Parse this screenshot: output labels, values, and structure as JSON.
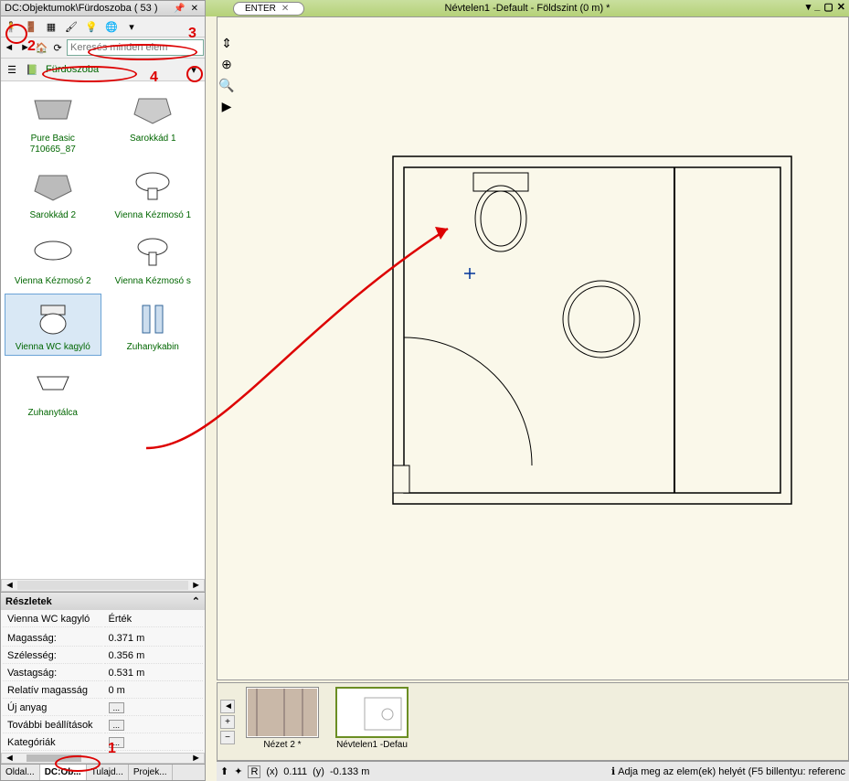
{
  "panel": {
    "title": "DC:Objektumok\\Fürdoszoba ( 53 )",
    "search_placeholder": "Keresés minden elem",
    "breadcrumb": "Fürdoszoba"
  },
  "objects": [
    {
      "label": "Pure Basic 710665_87"
    },
    {
      "label": "Sarokkád 1"
    },
    {
      "label": "Sarokkád 2"
    },
    {
      "label": "Vienna Kézmosó 1"
    },
    {
      "label": "Vienna Kézmosó 2"
    },
    {
      "label": "Vienna Kézmosó s"
    },
    {
      "label": "Vienna WC kagyló",
      "selected": true
    },
    {
      "label": "Zuhanykabin"
    },
    {
      "label": "Zuhanytálca"
    }
  ],
  "details": {
    "header": "Részletek",
    "name_label": "Vienna WC kagyló",
    "value_label": "Érték",
    "rows": [
      {
        "k": "Magasság:",
        "v": "0.371 m"
      },
      {
        "k": "Szélesség:",
        "v": "0.356 m"
      },
      {
        "k": "Vastagság:",
        "v": "0.531 m"
      },
      {
        "k": "Relatív magasság",
        "v": "0 m"
      },
      {
        "k": "Új anyag",
        "v": "..."
      },
      {
        "k": "További beállítások",
        "v": "..."
      },
      {
        "k": "Kategóriák",
        "v": "..."
      }
    ]
  },
  "bottom_tabs": [
    {
      "label": "Oldal...",
      "active": false
    },
    {
      "label": "DC:Ob...",
      "active": true
    },
    {
      "label": "Tulajd...",
      "active": false
    },
    {
      "label": "Projek...",
      "active": false
    }
  ],
  "main": {
    "title": "Névtelen1 -Default - Földszint (0 m) *",
    "tab": "ENTER",
    "previews": [
      {
        "label": "Nézet 2 *"
      },
      {
        "label": "Névtelen1 -Defau",
        "active": true
      }
    ],
    "coords_x_label": "(x)",
    "coords_x": "0.111",
    "coords_y_label": "(y)",
    "coords_y": "-0.133 m",
    "hint": "Adja meg az elem(ek) helyét (F5 billentyu: referenc"
  },
  "annotations": {
    "n1": "1",
    "n2": "2",
    "n3": "3",
    "n4": "4"
  }
}
